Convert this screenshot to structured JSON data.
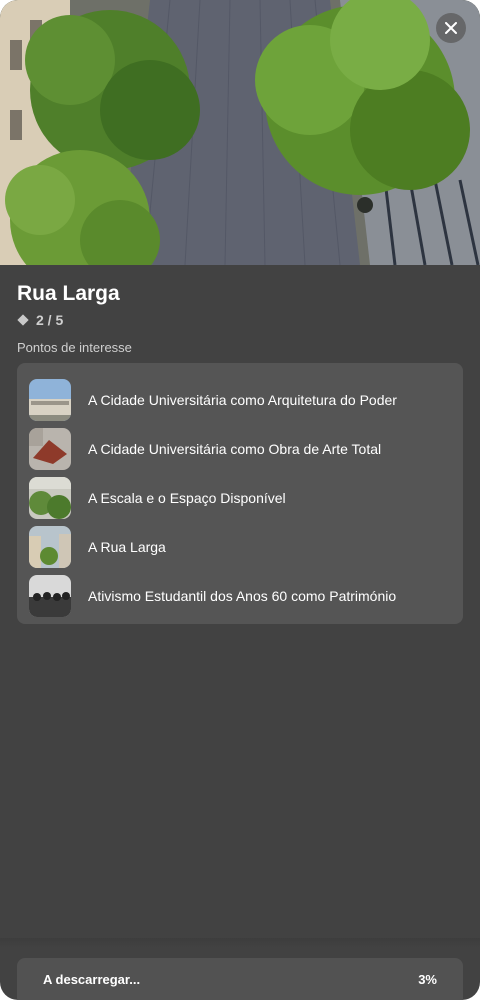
{
  "route": {
    "title": "Rua Larga",
    "progress": "2 / 5"
  },
  "section_label": "Pontos de interesse",
  "poi_items": [
    {
      "label": "A Cidade Universitária como Arquitetura do Poder"
    },
    {
      "label": "A Cidade Universitária como Obra de Arte Total"
    },
    {
      "label": "A Escala e o Espaço Disponível"
    },
    {
      "label": "A Rua Larga"
    },
    {
      "label": "Ativismo Estudantil dos Anos 60 como Património"
    }
  ],
  "download": {
    "label": "A descarregar...",
    "percent_text": "3%",
    "percent": 3
  },
  "icons": {
    "close": "close-icon",
    "progress": "diamond-icon"
  },
  "colors": {
    "panel": "#424242",
    "list_bg": "#555555",
    "text": "#ffffff"
  }
}
